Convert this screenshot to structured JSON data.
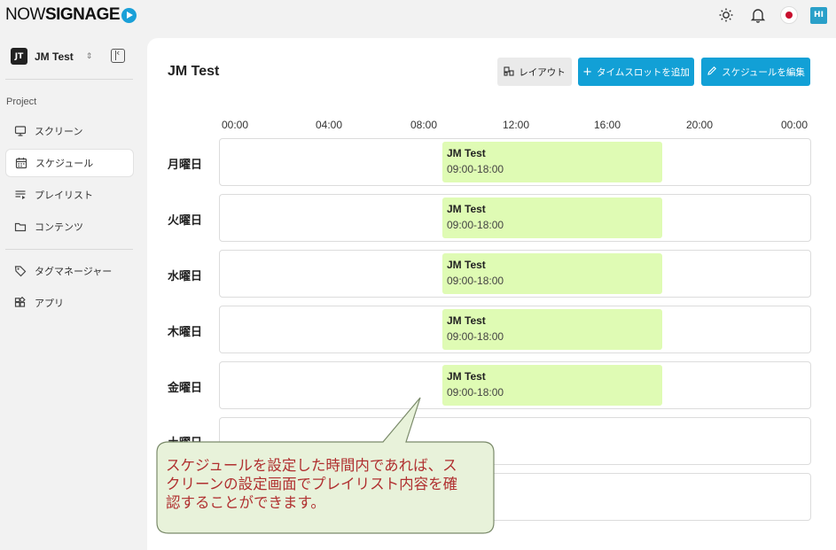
{
  "app": {
    "logo_now": "NOW",
    "logo_signage": "SIGNAGE",
    "user_initials": "HI"
  },
  "sidebar": {
    "project_initials": "JT",
    "project_name": "JM Test",
    "section_label": "Project",
    "items": [
      {
        "label": "スクリーン",
        "icon": "monitor-icon"
      },
      {
        "label": "スケジュール",
        "icon": "calendar-icon"
      },
      {
        "label": "プレイリスト",
        "icon": "playlist-icon"
      },
      {
        "label": "コンテンツ",
        "icon": "folder-icon"
      },
      {
        "label": "タグマネージャー",
        "icon": "tag-icon"
      },
      {
        "label": "アプリ",
        "icon": "apps-icon"
      }
    ]
  },
  "main": {
    "title": "JM Test",
    "buttons": {
      "layout": "レイアウト",
      "add_timeslot": "タイムスロットを追加",
      "edit_schedule": "スケジュールを編集"
    },
    "time_ticks": [
      "00:00",
      "04:00",
      "08:00",
      "12:00",
      "16:00",
      "20:00",
      "00:00"
    ],
    "days": [
      {
        "label": "月曜日",
        "slot": {
          "name": "JM Test",
          "time": "09:00-18:00"
        }
      },
      {
        "label": "火曜日",
        "slot": {
          "name": "JM Test",
          "time": "09:00-18:00"
        }
      },
      {
        "label": "水曜日",
        "slot": {
          "name": "JM Test",
          "time": "09:00-18:00"
        }
      },
      {
        "label": "木曜日",
        "slot": {
          "name": "JM Test",
          "time": "09:00-18:00"
        }
      },
      {
        "label": "金曜日",
        "slot": {
          "name": "JM Test",
          "time": "09:00-18:00"
        }
      },
      {
        "label": "土曜日",
        "slot": null
      },
      {
        "label": "",
        "slot": null
      }
    ]
  },
  "callout": {
    "lines": [
      "スケジュールを設定した時間内であれば、ス",
      "クリーンの設定画面でプレイリスト内容を確",
      "認することができます。"
    ]
  },
  "colors": {
    "accent": "#12a0d6",
    "slot_bg": "#dffbb4",
    "callout_bg": "#e8f2da",
    "callout_text": "#b03030"
  }
}
